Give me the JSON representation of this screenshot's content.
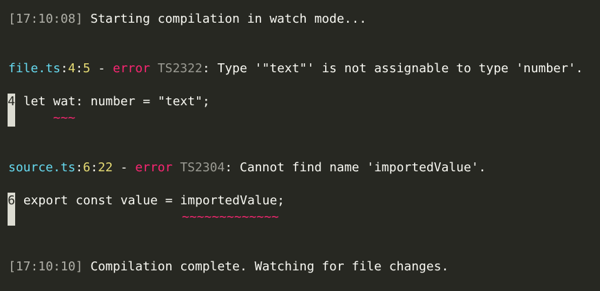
{
  "log1": {
    "timestamp": "17:10:08",
    "message": " Starting compilation in watch mode..."
  },
  "error1": {
    "file": "file.ts",
    "line": "4",
    "col": "5",
    "severity": "error",
    "code": "TS2322",
    "message": " Type '\"text\"' is not assignable to type 'number'.",
    "source_line_number": "4",
    "source": " let wat: number = \"text\";",
    "squiggle": "~~~"
  },
  "error2": {
    "file": "source.ts",
    "line": "6",
    "col": "22",
    "severity": "error",
    "code": "TS2304",
    "message": " Cannot find name 'importedValue'.",
    "source_line_number": "6",
    "source": " export const value = importedValue;",
    "squiggle": "~~~~~~~~~~~~~"
  },
  "log2": {
    "timestamp": "17:10:10",
    "message": " Compilation complete. Watching for file changes."
  },
  "colors": {
    "background": "#272822",
    "file": "#66d9ef",
    "position": "#e6db74",
    "error": "#f92672",
    "text": "#f8f8f2"
  }
}
